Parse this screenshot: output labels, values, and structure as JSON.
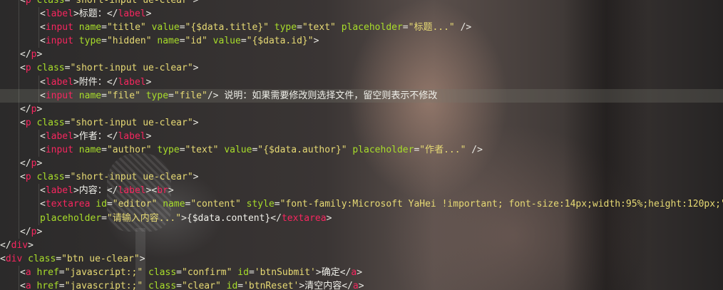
{
  "colors": {
    "tag": "#f7265f",
    "attribute": "#a8dd2a",
    "string": "#e7da74",
    "text": "#f0f0ea",
    "current_line": "#5a5954"
  },
  "code_lines": [
    {
      "indent": 1,
      "tokens": [
        {
          "t": "pun",
          "v": "<"
        },
        {
          "t": "tag",
          "v": "p"
        },
        {
          "t": "pun",
          "v": " "
        },
        {
          "t": "attr",
          "v": "class"
        },
        {
          "t": "pun",
          "v": "="
        },
        {
          "t": "str",
          "v": "\"short-input ue-clear\""
        },
        {
          "t": "pun",
          "v": ">"
        }
      ]
    },
    {
      "indent": 2,
      "tokens": [
        {
          "t": "pun",
          "v": "<"
        },
        {
          "t": "tag",
          "v": "label"
        },
        {
          "t": "pun",
          "v": ">"
        },
        {
          "t": "txt",
          "v": "标题："
        },
        {
          "t": "pun",
          "v": "</"
        },
        {
          "t": "tag",
          "v": "label"
        },
        {
          "t": "pun",
          "v": ">"
        }
      ]
    },
    {
      "indent": 2,
      "tokens": [
        {
          "t": "pun",
          "v": "<"
        },
        {
          "t": "tag",
          "v": "input"
        },
        {
          "t": "pun",
          "v": " "
        },
        {
          "t": "attr",
          "v": "name"
        },
        {
          "t": "pun",
          "v": "="
        },
        {
          "t": "str",
          "v": "\"title\""
        },
        {
          "t": "pun",
          "v": " "
        },
        {
          "t": "attr",
          "v": "value"
        },
        {
          "t": "pun",
          "v": "="
        },
        {
          "t": "str",
          "v": "\"{$data.title}\""
        },
        {
          "t": "pun",
          "v": " "
        },
        {
          "t": "attr",
          "v": "type"
        },
        {
          "t": "pun",
          "v": "="
        },
        {
          "t": "str",
          "v": "\"text\""
        },
        {
          "t": "pun",
          "v": " "
        },
        {
          "t": "attr",
          "v": "placeholder"
        },
        {
          "t": "pun",
          "v": "="
        },
        {
          "t": "str",
          "v": "\"标题...\""
        },
        {
          "t": "pun",
          "v": " />"
        }
      ]
    },
    {
      "indent": 2,
      "tokens": [
        {
          "t": "pun",
          "v": "<"
        },
        {
          "t": "tag",
          "v": "input"
        },
        {
          "t": "pun",
          "v": " "
        },
        {
          "t": "attr",
          "v": "type"
        },
        {
          "t": "pun",
          "v": "="
        },
        {
          "t": "str",
          "v": "\"hidden\""
        },
        {
          "t": "pun",
          "v": " "
        },
        {
          "t": "attr",
          "v": "name"
        },
        {
          "t": "pun",
          "v": "="
        },
        {
          "t": "str",
          "v": "\"id\""
        },
        {
          "t": "pun",
          "v": " "
        },
        {
          "t": "attr",
          "v": "value"
        },
        {
          "t": "pun",
          "v": "="
        },
        {
          "t": "str",
          "v": "\"{$data.id}\""
        },
        {
          "t": "pun",
          "v": ">"
        }
      ]
    },
    {
      "indent": 1,
      "tokens": [
        {
          "t": "pun",
          "v": "</"
        },
        {
          "t": "tag",
          "v": "p"
        },
        {
          "t": "pun",
          "v": ">"
        }
      ]
    },
    {
      "indent": 1,
      "tokens": [
        {
          "t": "pun",
          "v": "<"
        },
        {
          "t": "tag",
          "v": "p"
        },
        {
          "t": "pun",
          "v": " "
        },
        {
          "t": "attr",
          "v": "class"
        },
        {
          "t": "pun",
          "v": "="
        },
        {
          "t": "str",
          "v": "\"short-input ue-clear\""
        },
        {
          "t": "pun",
          "v": ">"
        }
      ]
    },
    {
      "indent": 2,
      "tokens": [
        {
          "t": "pun",
          "v": "<"
        },
        {
          "t": "tag",
          "v": "label"
        },
        {
          "t": "pun",
          "v": ">"
        },
        {
          "t": "txt",
          "v": "附件："
        },
        {
          "t": "pun",
          "v": "</"
        },
        {
          "t": "tag",
          "v": "label"
        },
        {
          "t": "pun",
          "v": ">"
        }
      ]
    },
    {
      "indent": 2,
      "current": true,
      "tokens": [
        {
          "t": "pun",
          "v": "<"
        },
        {
          "t": "tag",
          "v": "input"
        },
        {
          "t": "pun",
          "v": " "
        },
        {
          "t": "attr",
          "v": "name"
        },
        {
          "t": "pun",
          "v": "="
        },
        {
          "t": "str",
          "v": "\"file\""
        },
        {
          "t": "pun",
          "v": " "
        },
        {
          "t": "attr",
          "v": "type"
        },
        {
          "t": "pun",
          "v": "="
        },
        {
          "t": "str",
          "v": "\"file\""
        },
        {
          "t": "pun",
          "v": "/> "
        },
        {
          "t": "txt",
          "v": "说明：如果需要修改则选择文件，留空则表示不修改"
        }
      ]
    },
    {
      "indent": 1,
      "tokens": [
        {
          "t": "pun",
          "v": "</"
        },
        {
          "t": "tag",
          "v": "p"
        },
        {
          "t": "pun",
          "v": ">"
        }
      ]
    },
    {
      "indent": 1,
      "tokens": [
        {
          "t": "pun",
          "v": "<"
        },
        {
          "t": "tag",
          "v": "p"
        },
        {
          "t": "pun",
          "v": " "
        },
        {
          "t": "attr",
          "v": "class"
        },
        {
          "t": "pun",
          "v": "="
        },
        {
          "t": "str",
          "v": "\"short-input ue-clear\""
        },
        {
          "t": "pun",
          "v": ">"
        }
      ]
    },
    {
      "indent": 2,
      "tokens": [
        {
          "t": "pun",
          "v": "<"
        },
        {
          "t": "tag",
          "v": "label"
        },
        {
          "t": "pun",
          "v": ">"
        },
        {
          "t": "txt",
          "v": "作者："
        },
        {
          "t": "pun",
          "v": "</"
        },
        {
          "t": "tag",
          "v": "label"
        },
        {
          "t": "pun",
          "v": ">"
        }
      ]
    },
    {
      "indent": 2,
      "tokens": [
        {
          "t": "pun",
          "v": "<"
        },
        {
          "t": "tag",
          "v": "input"
        },
        {
          "t": "pun",
          "v": " "
        },
        {
          "t": "attr",
          "v": "name"
        },
        {
          "t": "pun",
          "v": "="
        },
        {
          "t": "str",
          "v": "\"author\""
        },
        {
          "t": "pun",
          "v": " "
        },
        {
          "t": "attr",
          "v": "type"
        },
        {
          "t": "pun",
          "v": "="
        },
        {
          "t": "str",
          "v": "\"text\""
        },
        {
          "t": "pun",
          "v": " "
        },
        {
          "t": "attr",
          "v": "value"
        },
        {
          "t": "pun",
          "v": "="
        },
        {
          "t": "str",
          "v": "\"{$data.author}\""
        },
        {
          "t": "pun",
          "v": " "
        },
        {
          "t": "attr",
          "v": "placeholder"
        },
        {
          "t": "pun",
          "v": "="
        },
        {
          "t": "str",
          "v": "\"作者...\""
        },
        {
          "t": "pun",
          "v": " />"
        }
      ]
    },
    {
      "indent": 1,
      "tokens": [
        {
          "t": "pun",
          "v": "</"
        },
        {
          "t": "tag",
          "v": "p"
        },
        {
          "t": "pun",
          "v": ">"
        }
      ]
    },
    {
      "indent": 1,
      "tokens": [
        {
          "t": "pun",
          "v": "<"
        },
        {
          "t": "tag",
          "v": "p"
        },
        {
          "t": "pun",
          "v": " "
        },
        {
          "t": "attr",
          "v": "class"
        },
        {
          "t": "pun",
          "v": "="
        },
        {
          "t": "str",
          "v": "\"short-input ue-clear\""
        },
        {
          "t": "pun",
          "v": ">"
        }
      ]
    },
    {
      "indent": 2,
      "tokens": [
        {
          "t": "pun",
          "v": "<"
        },
        {
          "t": "tag",
          "v": "label"
        },
        {
          "t": "pun",
          "v": ">"
        },
        {
          "t": "txt",
          "v": "内容："
        },
        {
          "t": "pun",
          "v": "</"
        },
        {
          "t": "tag",
          "v": "label"
        },
        {
          "t": "pun",
          "v": "><"
        },
        {
          "t": "tag",
          "v": "br"
        },
        {
          "t": "pun",
          "v": ">"
        }
      ]
    },
    {
      "indent": 2,
      "tokens": [
        {
          "t": "pun",
          "v": "<"
        },
        {
          "t": "tag",
          "v": "textarea"
        },
        {
          "t": "pun",
          "v": " "
        },
        {
          "t": "attr",
          "v": "id"
        },
        {
          "t": "pun",
          "v": "="
        },
        {
          "t": "str",
          "v": "\"editor\""
        },
        {
          "t": "pun",
          "v": " "
        },
        {
          "t": "attr",
          "v": "name"
        },
        {
          "t": "pun",
          "v": "="
        },
        {
          "t": "str",
          "v": "\"content\""
        },
        {
          "t": "pun",
          "v": " "
        },
        {
          "t": "attr",
          "v": "style"
        },
        {
          "t": "pun",
          "v": "="
        },
        {
          "t": "str",
          "v": "\"font-family:Microsoft YaHei !important; font-size:14px;width:95%;height:120px;\""
        }
      ]
    },
    {
      "indent": 2,
      "tokens": [
        {
          "t": "attr",
          "v": "placeholder"
        },
        {
          "t": "pun",
          "v": "="
        },
        {
          "t": "str",
          "v": "\"请输入内容...\""
        },
        {
          "t": "pun",
          "v": ">"
        },
        {
          "t": "txt",
          "v": "{$data.content}"
        },
        {
          "t": "pun",
          "v": "</"
        },
        {
          "t": "tag",
          "v": "textarea"
        },
        {
          "t": "pun",
          "v": ">"
        }
      ]
    },
    {
      "indent": 1,
      "tokens": [
        {
          "t": "pun",
          "v": "</"
        },
        {
          "t": "tag",
          "v": "p"
        },
        {
          "t": "pun",
          "v": ">"
        }
      ]
    },
    {
      "indent": 0,
      "tokens": [
        {
          "t": "pun",
          "v": "</"
        },
        {
          "t": "tag",
          "v": "div"
        },
        {
          "t": "pun",
          "v": ">"
        }
      ]
    },
    {
      "indent": 0,
      "tokens": [
        {
          "t": "pun",
          "v": "<"
        },
        {
          "t": "tag",
          "v": "div"
        },
        {
          "t": "pun",
          "v": " "
        },
        {
          "t": "attr",
          "v": "class"
        },
        {
          "t": "pun",
          "v": "="
        },
        {
          "t": "str",
          "v": "\"btn ue-clear\""
        },
        {
          "t": "pun",
          "v": ">"
        }
      ]
    },
    {
      "indent": 1,
      "tokens": [
        {
          "t": "pun",
          "v": "<"
        },
        {
          "t": "tag",
          "v": "a"
        },
        {
          "t": "pun",
          "v": " "
        },
        {
          "t": "attr",
          "v": "href"
        },
        {
          "t": "pun",
          "v": "="
        },
        {
          "t": "str",
          "v": "\"javascript:;\""
        },
        {
          "t": "pun",
          "v": " "
        },
        {
          "t": "attr",
          "v": "class"
        },
        {
          "t": "pun",
          "v": "="
        },
        {
          "t": "str",
          "v": "\"confirm\""
        },
        {
          "t": "pun",
          "v": " "
        },
        {
          "t": "attr",
          "v": "id"
        },
        {
          "t": "pun",
          "v": "="
        },
        {
          "t": "str",
          "v": "'btnSubmit'"
        },
        {
          "t": "pun",
          "v": ">"
        },
        {
          "t": "txt",
          "v": "确定"
        },
        {
          "t": "pun",
          "v": "</"
        },
        {
          "t": "tag",
          "v": "a"
        },
        {
          "t": "pun",
          "v": ">"
        }
      ]
    },
    {
      "indent": 1,
      "tokens": [
        {
          "t": "pun",
          "v": "<"
        },
        {
          "t": "tag",
          "v": "a"
        },
        {
          "t": "pun",
          "v": " "
        },
        {
          "t": "attr",
          "v": "href"
        },
        {
          "t": "pun",
          "v": "="
        },
        {
          "t": "str",
          "v": "\"javascript:;\""
        },
        {
          "t": "pun",
          "v": " "
        },
        {
          "t": "attr",
          "v": "class"
        },
        {
          "t": "pun",
          "v": "="
        },
        {
          "t": "str",
          "v": "\"clear\""
        },
        {
          "t": "pun",
          "v": " "
        },
        {
          "t": "attr",
          "v": "id"
        },
        {
          "t": "pun",
          "v": "="
        },
        {
          "t": "str",
          "v": "'btnReset'"
        },
        {
          "t": "pun",
          "v": ">"
        },
        {
          "t": "txt",
          "v": "清空内容"
        },
        {
          "t": "pun",
          "v": "</"
        },
        {
          "t": "tag",
          "v": "a"
        },
        {
          "t": "pun",
          "v": ">"
        }
      ]
    }
  ]
}
